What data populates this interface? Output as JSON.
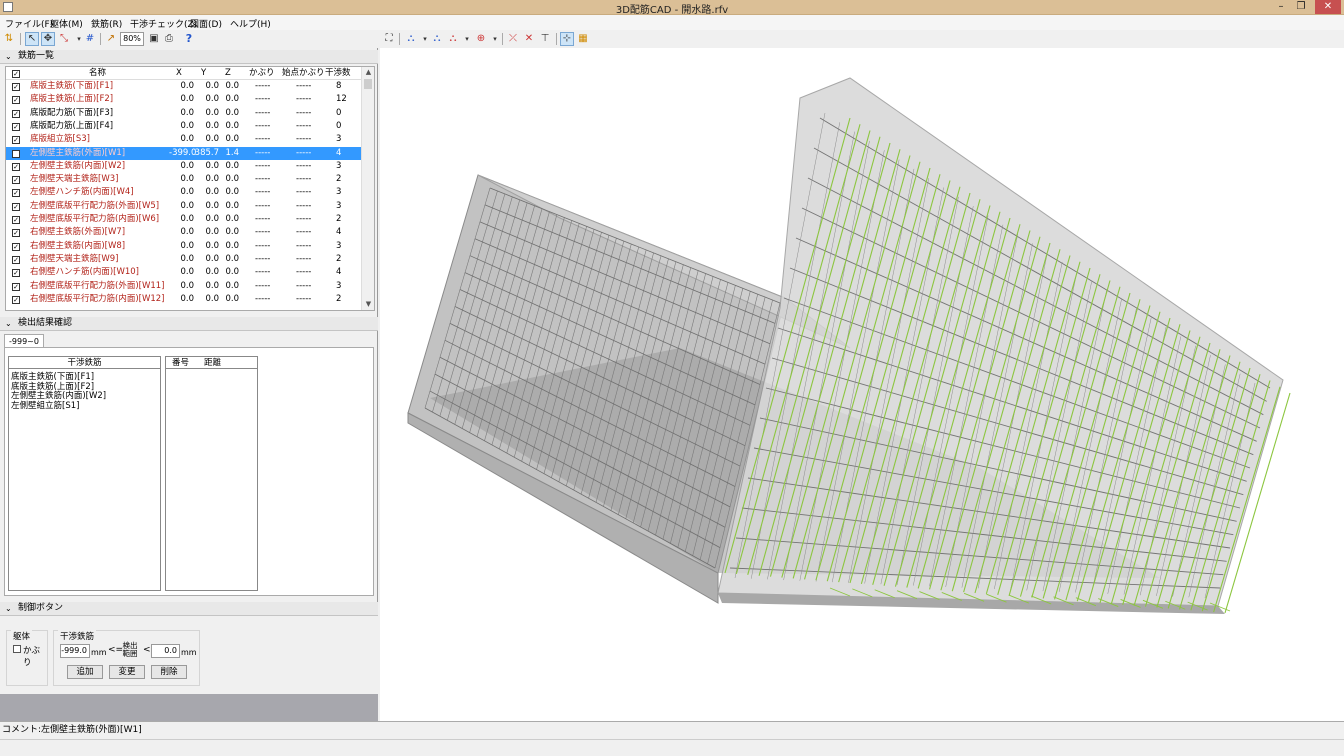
{
  "window": {
    "title": "3D配筋CAD - 開水路.rfv",
    "min_glyph": "–",
    "max_glyph": "❐",
    "close_glyph": "✕"
  },
  "menu": [
    "ファイル(F)",
    "躯体(M)",
    "鉄筋(R)",
    "干渉チェック(Z)",
    "図面(D)",
    "ヘルプ(H)"
  ],
  "toolbar": {
    "zoom": "80%",
    "help_glyph": "?"
  },
  "rebar_list": {
    "section_title": "鉄筋一覧",
    "columns": {
      "name": "名称",
      "x": "X",
      "y": "Y",
      "z": "Z",
      "cover": "かぶり",
      "start_cover": "始点かぶり",
      "interference": "干渉数"
    },
    "rows": [
      {
        "name": "底版主鉄筋(下面)[F1]",
        "x": "0.0",
        "y": "0.0",
        "z": "0.0",
        "cover": "-----",
        "start_cover": "-----",
        "count": "8",
        "red": true
      },
      {
        "name": "底版主鉄筋(上面)[F2]",
        "x": "0.0",
        "y": "0.0",
        "z": "0.0",
        "cover": "-----",
        "start_cover": "-----",
        "count": "12",
        "red": true
      },
      {
        "name": "底版配力筋(下面)[F3]",
        "x": "0.0",
        "y": "0.0",
        "z": "0.0",
        "cover": "-----",
        "start_cover": "-----",
        "count": "0",
        "red": false
      },
      {
        "name": "底版配力筋(上面)[F4]",
        "x": "0.0",
        "y": "0.0",
        "z": "0.0",
        "cover": "-----",
        "start_cover": "-----",
        "count": "0",
        "red": false
      },
      {
        "name": "底版組立筋[S3]",
        "x": "0.0",
        "y": "0.0",
        "z": "0.0",
        "cover": "-----",
        "start_cover": "-----",
        "count": "3",
        "red": true
      },
      {
        "name": "左側壁主鉄筋(外面)[W1]",
        "x": "-399.0",
        "y": "385.7",
        "z": "1.4",
        "cover": "-----",
        "start_cover": "-----",
        "count": "4",
        "red": true,
        "selected": true
      },
      {
        "name": "左側壁主鉄筋(内面)[W2]",
        "x": "0.0",
        "y": "0.0",
        "z": "0.0",
        "cover": "-----",
        "start_cover": "-----",
        "count": "3",
        "red": true
      },
      {
        "name": "左側壁天端主鉄筋[W3]",
        "x": "0.0",
        "y": "0.0",
        "z": "0.0",
        "cover": "-----",
        "start_cover": "-----",
        "count": "2",
        "red": true
      },
      {
        "name": "左側壁ハンチ筋(内面)[W4]",
        "x": "0.0",
        "y": "0.0",
        "z": "0.0",
        "cover": "-----",
        "start_cover": "-----",
        "count": "3",
        "red": true
      },
      {
        "name": "左側壁底版平行配力筋(外面)[W5]",
        "x": "0.0",
        "y": "0.0",
        "z": "0.0",
        "cover": "-----",
        "start_cover": "-----",
        "count": "3",
        "red": true
      },
      {
        "name": "左側壁底版平行配力筋(内面)[W6]",
        "x": "0.0",
        "y": "0.0",
        "z": "0.0",
        "cover": "-----",
        "start_cover": "-----",
        "count": "2",
        "red": true
      },
      {
        "name": "右側壁主鉄筋(外面)[W7]",
        "x": "0.0",
        "y": "0.0",
        "z": "0.0",
        "cover": "-----",
        "start_cover": "-----",
        "count": "4",
        "red": true
      },
      {
        "name": "右側壁主鉄筋(内面)[W8]",
        "x": "0.0",
        "y": "0.0",
        "z": "0.0",
        "cover": "-----",
        "start_cover": "-----",
        "count": "3",
        "red": true
      },
      {
        "name": "右側壁天端主鉄筋[W9]",
        "x": "0.0",
        "y": "0.0",
        "z": "0.0",
        "cover": "-----",
        "start_cover": "-----",
        "count": "2",
        "red": true
      },
      {
        "name": "右側壁ハンチ筋(内面)[W10]",
        "x": "0.0",
        "y": "0.0",
        "z": "0.0",
        "cover": "-----",
        "start_cover": "-----",
        "count": "4",
        "red": true
      },
      {
        "name": "右側壁底版平行配力筋(外面)[W11]",
        "x": "0.0",
        "y": "0.0",
        "z": "0.0",
        "cover": "-----",
        "start_cover": "-----",
        "count": "3",
        "red": true
      },
      {
        "name": "右側壁底版平行配力筋(内面)[W12]",
        "x": "0.0",
        "y": "0.0",
        "z": "0.0",
        "cover": "-----",
        "start_cover": "-----",
        "count": "2",
        "red": true
      }
    ]
  },
  "detection": {
    "section_title": "検出結果確認",
    "tab_label": "-999~0",
    "left_box_title": "干渉鉄筋",
    "left_items": [
      "底版主鉄筋(下面)[F1]",
      "底版主鉄筋(上面)[F2]",
      "左側壁主鉄筋(内面)[W2]",
      "左側壁組立筋[S1]"
    ],
    "col_number": "番号",
    "col_distance": "距離"
  },
  "control": {
    "section_title": "制御ボタン",
    "body_group": "躯体",
    "cover_checkbox": "かぶり",
    "rebar_group": "干渉鉄筋",
    "min_value": "-999.0",
    "max_value": "0.0",
    "unit": "mm",
    "le_symbol": "<=",
    "lt_symbol": "<",
    "range_label": "検出範囲",
    "add_button": "追加",
    "change_button": "変更",
    "delete_button": "削除"
  },
  "status": {
    "comment": "コメント:左側壁主鉄筋(外面)[W1]"
  },
  "colors": {
    "title_bar": "#dbbf96",
    "selection": "#3399ff",
    "rebar_green": "#8cc63f",
    "concrete": "#bdbdbd",
    "red_text": "#b2231a"
  }
}
